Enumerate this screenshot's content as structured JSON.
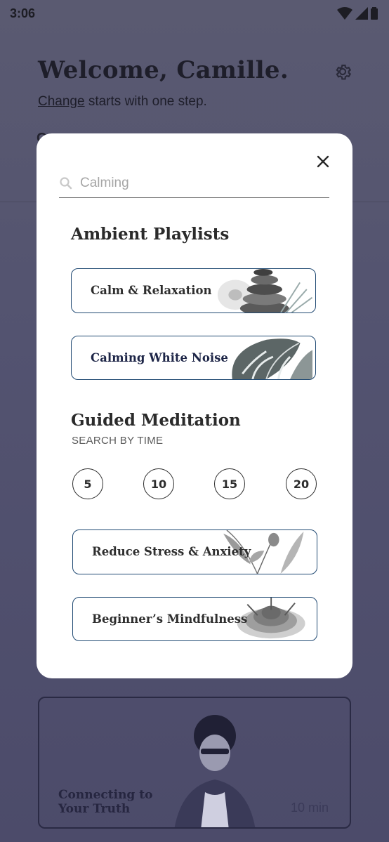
{
  "status": {
    "time": "3:06"
  },
  "background": {
    "title": "Welcome, Camille.",
    "subtitle_link": "Change",
    "subtitle_rest": " starts with one step.",
    "card": {
      "title": "Connecting to\nYour Truth",
      "duration": "10 min"
    }
  },
  "modal": {
    "search": {
      "value": "Calming"
    },
    "ambient": {
      "title": "Ambient Playlists",
      "items": [
        {
          "label": "Calm & Relaxation"
        },
        {
          "label": "Calming White Noise"
        }
      ]
    },
    "guided": {
      "title": "Guided Meditation",
      "subtitle": "SEARCH BY TIME",
      "times": [
        "5",
        "10",
        "15",
        "20"
      ],
      "items": [
        {
          "label": "Reduce Stress & Anxiety"
        },
        {
          "label": "Beginner’s Mindfulness"
        }
      ]
    }
  },
  "colors": {
    "overlay": "#535370",
    "accent_border": "#214a73",
    "card_border": "#2a2a44"
  },
  "icons": {
    "settings": "gear-icon",
    "close": "close-icon",
    "search": "search-icon"
  }
}
